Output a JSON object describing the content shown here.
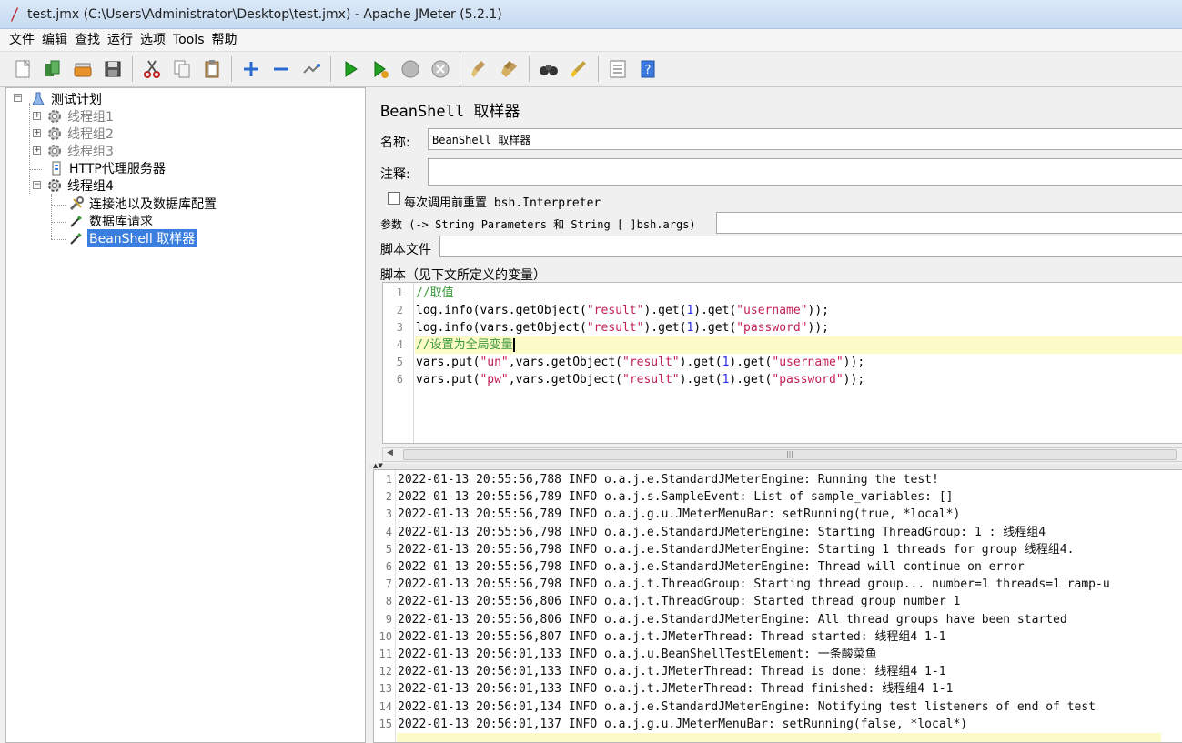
{
  "window": {
    "title": "test.jmx (C:\\Users\\Administrator\\Desktop\\test.jmx) - Apache JMeter (5.2.1)"
  },
  "menu": [
    "文件",
    "编辑",
    "查找",
    "运行",
    "选项",
    "Tools",
    "帮助"
  ],
  "toolbar": {
    "icons": [
      "new-icon",
      "templates-icon",
      "open-icon",
      "save-icon",
      "cut-icon",
      "copy-icon",
      "paste-icon",
      "expand-icon",
      "collapse-icon",
      "toggle-icon",
      "start-icon",
      "start-no-pause-icon",
      "stop-icon",
      "shutdown-icon",
      "clear-icon",
      "clear-all-icon",
      "search-icon",
      "reset-search-icon",
      "function-helper-icon",
      "help-icon"
    ]
  },
  "tree": {
    "root": "测试计划",
    "items": [
      {
        "label": "线程组1",
        "disabled": true
      },
      {
        "label": "线程组2",
        "disabled": true
      },
      {
        "label": "线程组3",
        "disabled": true
      },
      {
        "label": "HTTP代理服务器",
        "disabled": false
      },
      {
        "label": "线程组4",
        "disabled": false
      }
    ],
    "children4": [
      "连接池以及数据库配置",
      "数据库请求",
      "BeanShell 取样器"
    ]
  },
  "panel": {
    "title": "BeanShell 取样器",
    "name_label": "名称:",
    "name_value": "BeanShell 取样器",
    "comment_label": "注释:",
    "comment_value": "",
    "reset_label": "每次调用前重置 bsh.Interpreter",
    "params_label": "参数 (-> String Parameters 和 String [ ]bsh.args)",
    "params_value": "",
    "script_file_label": "脚本文件",
    "script_file_value": "",
    "script_label": "脚本（见下文所定义的变量）"
  },
  "script": {
    "highlight_line": 4,
    "lines": [
      {
        "n": "1",
        "parts": [
          [
            "c",
            "//取值"
          ]
        ]
      },
      {
        "n": "2",
        "parts": [
          [
            "d",
            "log.info(vars.getObject("
          ],
          [
            "s",
            "\"result\""
          ],
          [
            "d",
            ").get("
          ],
          [
            "n",
            "1"
          ],
          [
            "d",
            ").get("
          ],
          [
            "s",
            "\"username\""
          ],
          [
            "d",
            "));"
          ]
        ]
      },
      {
        "n": "3",
        "parts": [
          [
            "d",
            "log.info(vars.getObject("
          ],
          [
            "s",
            "\"result\""
          ],
          [
            "d",
            ").get("
          ],
          [
            "n",
            "1"
          ],
          [
            "d",
            ").get("
          ],
          [
            "s",
            "\"password\""
          ],
          [
            "d",
            "));"
          ]
        ]
      },
      {
        "n": "4",
        "parts": [
          [
            "c",
            "//设置为全局变量"
          ]
        ]
      },
      {
        "n": "5",
        "parts": [
          [
            "d",
            "vars.put("
          ],
          [
            "s",
            "\"un\""
          ],
          [
            "d",
            ",vars.getObject("
          ],
          [
            "s",
            "\"result\""
          ],
          [
            "d",
            ").get("
          ],
          [
            "n",
            "1"
          ],
          [
            "d",
            ").get("
          ],
          [
            "s",
            "\"username\""
          ],
          [
            "d",
            "));"
          ]
        ]
      },
      {
        "n": "6",
        "parts": [
          [
            "d",
            "vars.put("
          ],
          [
            "s",
            "\"pw\""
          ],
          [
            "d",
            ",vars.getObject("
          ],
          [
            "s",
            "\"result\""
          ],
          [
            "d",
            ").get("
          ],
          [
            "n",
            "1"
          ],
          [
            "d",
            ").get("
          ],
          [
            "s",
            "\"password\""
          ],
          [
            "d",
            "));"
          ]
        ]
      }
    ]
  },
  "log": [
    {
      "n": "1",
      "text": "2022-01-13 20:55:56,788 INFO o.a.j.e.StandardJMeterEngine: Running the test!"
    },
    {
      "n": "2",
      "text": "2022-01-13 20:55:56,789 INFO o.a.j.s.SampleEvent: List of sample_variables: []"
    },
    {
      "n": "3",
      "text": "2022-01-13 20:55:56,789 INFO o.a.j.g.u.JMeterMenuBar: setRunning(true, *local*)"
    },
    {
      "n": "4",
      "text": "2022-01-13 20:55:56,798 INFO o.a.j.e.StandardJMeterEngine: Starting ThreadGroup: 1 : 线程组4"
    },
    {
      "n": "5",
      "text": "2022-01-13 20:55:56,798 INFO o.a.j.e.StandardJMeterEngine: Starting 1 threads for group 线程组4."
    },
    {
      "n": "6",
      "text": "2022-01-13 20:55:56,798 INFO o.a.j.e.StandardJMeterEngine: Thread will continue on error"
    },
    {
      "n": "7",
      "text": "2022-01-13 20:55:56,798 INFO o.a.j.t.ThreadGroup: Starting thread group... number=1 threads=1 ramp-u"
    },
    {
      "n": "8",
      "text": "2022-01-13 20:55:56,806 INFO o.a.j.t.ThreadGroup: Started thread group number 1"
    },
    {
      "n": "9",
      "text": "2022-01-13 20:55:56,806 INFO o.a.j.e.StandardJMeterEngine: All thread groups have been started"
    },
    {
      "n": "10",
      "text": "2022-01-13 20:55:56,807 INFO o.a.j.t.JMeterThread: Thread started: 线程组4 1-1"
    },
    {
      "n": "11",
      "text": "2022-01-13 20:56:01,133 INFO o.a.j.u.BeanShellTestElement: 一条酸菜鱼"
    },
    {
      "n": "12",
      "text": "2022-01-13 20:56:01,133 INFO o.a.j.t.JMeterThread: Thread is done: 线程组4 1-1"
    },
    {
      "n": "13",
      "text": "2022-01-13 20:56:01,133 INFO o.a.j.t.JMeterThread: Thread finished: 线程组4 1-1"
    },
    {
      "n": "14",
      "text": "2022-01-13 20:56:01,134 INFO o.a.j.e.StandardJMeterEngine: Notifying test listeners of end of test"
    },
    {
      "n": "15",
      "text": "2022-01-13 20:56:01,137 INFO o.a.j.g.u.JMeterMenuBar: setRunning(false, *local*)"
    }
  ],
  "colors": {
    "selection": "#3a7ee0",
    "comment": "#3c9a3c",
    "string": "#c21e56",
    "number": "#2a2adf",
    "line_highlight": "#fcfbc7"
  }
}
